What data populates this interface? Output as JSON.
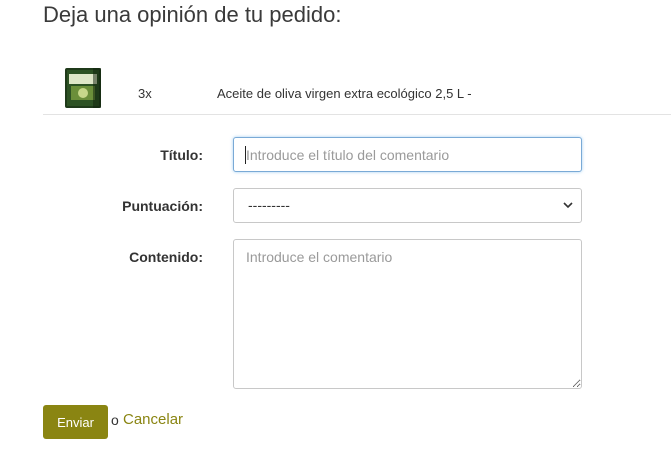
{
  "page": {
    "title": "Deja una opinión de tu pedido:"
  },
  "product": {
    "image_icon": "olive-oil-can-icon",
    "image_label": "Aceite de oliva",
    "quantity": "3x",
    "name": "Aceite de oliva virgen extra ecológico 2,5 L -"
  },
  "form": {
    "title_label": "Título:",
    "title_placeholder": "Introduce el título del comentario",
    "rating_label": "Puntuación:",
    "rating_selected": "---------",
    "content_label": "Contenido:",
    "content_placeholder": "Introduce el comentario"
  },
  "actions": {
    "submit_label": "Enviar",
    "or_text": "o",
    "cancel_label": "Cancelar"
  },
  "colors": {
    "accent": "#8a8512",
    "focus_border": "#7aaad6"
  }
}
